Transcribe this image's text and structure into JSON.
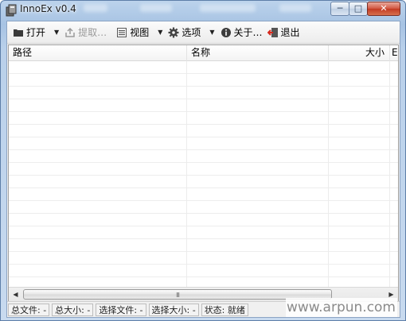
{
  "window": {
    "title": "InnoEx v0.4"
  },
  "toolbar": {
    "open_label": "打开",
    "extract_label": "提取…",
    "view_label": "视图",
    "options_label": "选项",
    "about_label": "关于…",
    "exit_label": "退出"
  },
  "list": {
    "columns": [
      "路径",
      "名称",
      "大小",
      "E"
    ]
  },
  "scrollbar": {
    "grip": "III"
  },
  "status": {
    "total_files": "总文件: -",
    "total_size": "总大小: -",
    "selected_files": "选择文件: -",
    "selected_size": "选择大小: -",
    "state": "状态: 就绪"
  },
  "watermark": "www.arpun.com",
  "colors": {
    "accent": "#4a76b1",
    "close": "#c8452d"
  }
}
